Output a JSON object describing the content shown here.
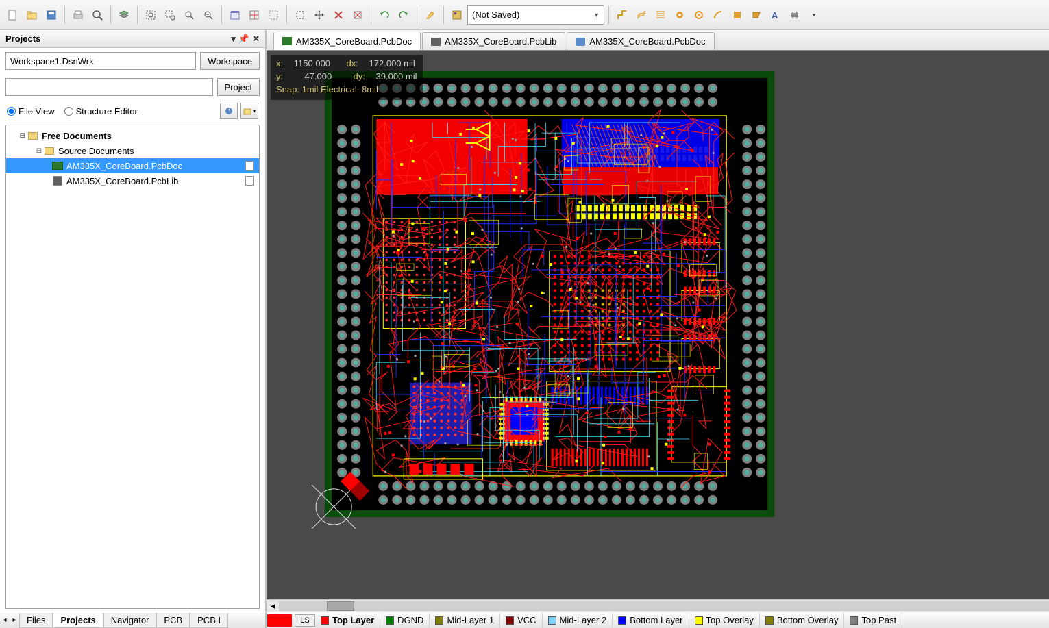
{
  "toolbar": {
    "combo_text": "(Not Saved)"
  },
  "panel": {
    "title": "Projects",
    "workspace_value": "Workspace1.DsnWrk",
    "workspace_btn": "Workspace",
    "project_value": "",
    "project_btn": "Project",
    "radio_file": "File View",
    "radio_struct": "Structure Editor",
    "tree": {
      "root": "Free Documents",
      "source": "Source Documents",
      "doc1": "AM335X_CoreBoard.PcbDoc",
      "doc2": "AM335X_CoreBoard.PcbLib"
    }
  },
  "doc_tabs": [
    {
      "label": "AM335X_CoreBoard.PcbDoc",
      "active": true,
      "icon": "pcb"
    },
    {
      "label": "AM335X_CoreBoard.PcbLib",
      "active": false,
      "icon": "lib"
    },
    {
      "label": "AM335X_CoreBoard.PcbDoc",
      "active": false,
      "icon": "pref"
    }
  ],
  "coords": {
    "x_label": "x:",
    "x_val": "1150.000",
    "dx_label": "dx:",
    "dx_val": "172.000 mil",
    "y_label": "y:",
    "y_val": "47.000",
    "dy_label": "dy:",
    "dy_val": "39.000  mil",
    "snap": "Snap: 1mil Electrical: 8mil"
  },
  "status_tabs": {
    "left": [
      {
        "label": "Files",
        "active": false
      },
      {
        "label": "Projects",
        "active": true
      },
      {
        "label": "Navigator",
        "active": false
      },
      {
        "label": "PCB",
        "active": false
      },
      {
        "label": "PCB I",
        "active": false
      }
    ]
  },
  "layer_tabs": {
    "ls_label": "LS",
    "ls_color": "#ff0000",
    "items": [
      {
        "label": "Top Layer",
        "color": "#ff0000",
        "active": true
      },
      {
        "label": "DGND",
        "color": "#008000",
        "active": false
      },
      {
        "label": "Mid-Layer 1",
        "color": "#808000",
        "active": false
      },
      {
        "label": "VCC",
        "color": "#800000",
        "active": false
      },
      {
        "label": "Mid-Layer 2",
        "color": "#80d4ff",
        "active": false
      },
      {
        "label": "Bottom Layer",
        "color": "#0000ff",
        "active": false
      },
      {
        "label": "Top Overlay",
        "color": "#ffff00",
        "active": false
      },
      {
        "label": "Bottom Overlay",
        "color": "#808000",
        "active": false
      },
      {
        "label": "Top Past",
        "color": "#808080",
        "active": false
      }
    ]
  }
}
